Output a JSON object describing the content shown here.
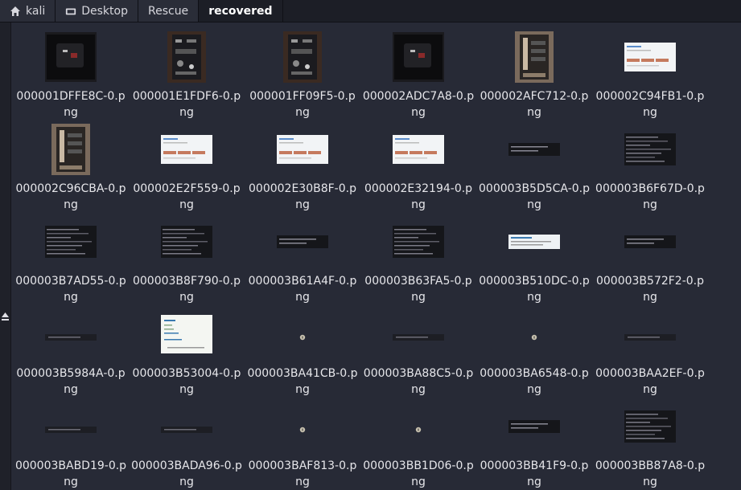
{
  "breadcrumb": [
    {
      "label": "kali",
      "icon": "home-icon"
    },
    {
      "label": "Desktop",
      "icon": "folder-icon"
    },
    {
      "label": "Rescue"
    },
    {
      "label": "recovered",
      "active": true
    }
  ],
  "sidebar": {
    "toggle_icon": "eject-arrow-icon"
  },
  "files": [
    {
      "name": "000001DFFE8C-0.png",
      "thumb": "device-dark"
    },
    {
      "name": "000001E1FDF6-0.png",
      "thumb": "device-board"
    },
    {
      "name": "000001FF09F5-0.png",
      "thumb": "device-board"
    },
    {
      "name": "000002ADC7A8-0.png",
      "thumb": "device-dark"
    },
    {
      "name": "000002AFC712-0.png",
      "thumb": "device-photo"
    },
    {
      "name": "000002C94FB1-0.png",
      "thumb": "web-light"
    },
    {
      "name": "000002C96CBA-0.png",
      "thumb": "device-photo"
    },
    {
      "name": "000002E2F559-0.png",
      "thumb": "web-light"
    },
    {
      "name": "000002E30B8F-0.png",
      "thumb": "web-light"
    },
    {
      "name": "000002E32194-0.png",
      "thumb": "web-light"
    },
    {
      "name": "000003B5D5CA-0.png",
      "thumb": "term-strip"
    },
    {
      "name": "000003B6F67D-0.png",
      "thumb": "term-block"
    },
    {
      "name": "000003B7AD55-0.png",
      "thumb": "term-block"
    },
    {
      "name": "000003B8F790-0.png",
      "thumb": "term-block"
    },
    {
      "name": "000003B61A4F-0.png",
      "thumb": "term-strip"
    },
    {
      "name": "000003B63FA5-0.png",
      "thumb": "term-block"
    },
    {
      "name": "000003B510DC-0.png",
      "thumb": "web-strip"
    },
    {
      "name": "000003B572F2-0.png",
      "thumb": "term-strip"
    },
    {
      "name": "000003B5984A-0.png",
      "thumb": "term-thin"
    },
    {
      "name": "000003B53004-0.png",
      "thumb": "web-doc"
    },
    {
      "name": "000003BA41CB-0.png",
      "thumb": "dot"
    },
    {
      "name": "000003BA88C5-0.png",
      "thumb": "term-thin"
    },
    {
      "name": "000003BA6548-0.png",
      "thumb": "dot"
    },
    {
      "name": "000003BAA2EF-0.png",
      "thumb": "term-thin"
    },
    {
      "name": "000003BABD19-0.png",
      "thumb": "term-thin"
    },
    {
      "name": "000003BADA96-0.png",
      "thumb": "term-thin"
    },
    {
      "name": "000003BAF813-0.png",
      "thumb": "dot"
    },
    {
      "name": "000003BB1D06-0.png",
      "thumb": "dot"
    },
    {
      "name": "000003BB41F9-0.png",
      "thumb": "term-strip"
    },
    {
      "name": "000003BB87A8-0.png",
      "thumb": "term-block"
    }
  ]
}
